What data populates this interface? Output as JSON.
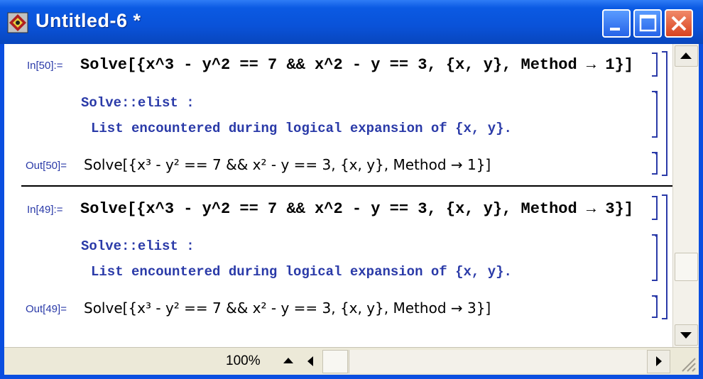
{
  "window": {
    "title": "Untitled-6 *"
  },
  "cells": [
    {
      "in_label": "In[50]:=",
      "input": "Solve[{x^3 - y^2 == 7 && x^2 - y == 3, {x, y}, Method → 1}]",
      "msg_name": "Solve::elist :",
      "msg_text": "List encountered during logical expansion of {x, y}.",
      "out_label": "Out[50]=",
      "output": "Solve[{x³ - y² == 7 && x² - y == 3, {x, y}, Method → 1}]"
    },
    {
      "in_label": "In[49]:=",
      "input": "Solve[{x^3 - y^2 == 7 && x^2 - y == 3, {x, y}, Method → 3}]",
      "msg_name": "Solve::elist :",
      "msg_text": "List encountered during logical expansion of {x, y}.",
      "out_label": "Out[49]=",
      "output": "Solve[{x³ - y² == 7 && x² - y == 3, {x, y}, Method → 3}]"
    }
  ],
  "statusbar": {
    "zoom": "100%"
  },
  "colors": {
    "titlebar": "#0a52d8",
    "label_blue": "#2a3aa8",
    "close_button": "#d9431f"
  },
  "icons": {
    "app": "mathematica-icon",
    "minimize": "minimize-icon",
    "maximize": "maximize-icon",
    "close": "close-icon"
  }
}
